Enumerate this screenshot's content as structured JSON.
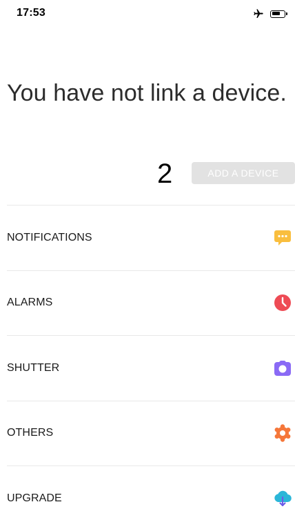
{
  "status_bar": {
    "time": "17:53",
    "icons": [
      "airplane-icon",
      "battery-icon"
    ],
    "battery_level": 0.7
  },
  "headline": "You have not link a device.",
  "device_count": "2",
  "add_device_button": "ADD A DEVICE",
  "menu": {
    "items": [
      {
        "label": "NOTIFICATIONS",
        "icon": "chat-bubble-icon",
        "color": "#F9BE3E"
      },
      {
        "label": "ALARMS",
        "icon": "clock-icon",
        "color": "#EE4B55"
      },
      {
        "label": "SHUTTER",
        "icon": "camera-icon",
        "color": "#8A6AF5"
      },
      {
        "label": "OTHERS",
        "icon": "gear-icon",
        "color": "#F5773A"
      },
      {
        "label": "UPGRADE",
        "icon": "cloud-download-icon",
        "color": "#2BB6D8"
      }
    ]
  },
  "colors": {
    "button_bg": "#E2E2E2",
    "divider": "#E8E8E8"
  }
}
